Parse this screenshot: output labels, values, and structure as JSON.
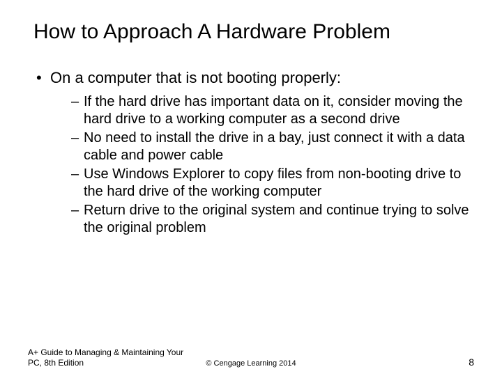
{
  "title": "How to Approach A Hardware Problem",
  "bullet1": "On a computer that is not booting properly:",
  "sub": {
    "a": "If the hard drive has important data on it, consider moving the hard drive to a working computer as a second drive",
    "b": "No need to install the drive in a bay, just connect it with a data cable and power cable",
    "c": "Use Windows Explorer to copy files from non-booting drive to the hard drive of the working computer",
    "d": "Return drive to the original system and continue trying to solve the original problem"
  },
  "footer": {
    "left": "A+ Guide to Managing & Maintaining Your PC, 8th Edition",
    "center": "© Cengage Learning  2014",
    "right": "8"
  }
}
